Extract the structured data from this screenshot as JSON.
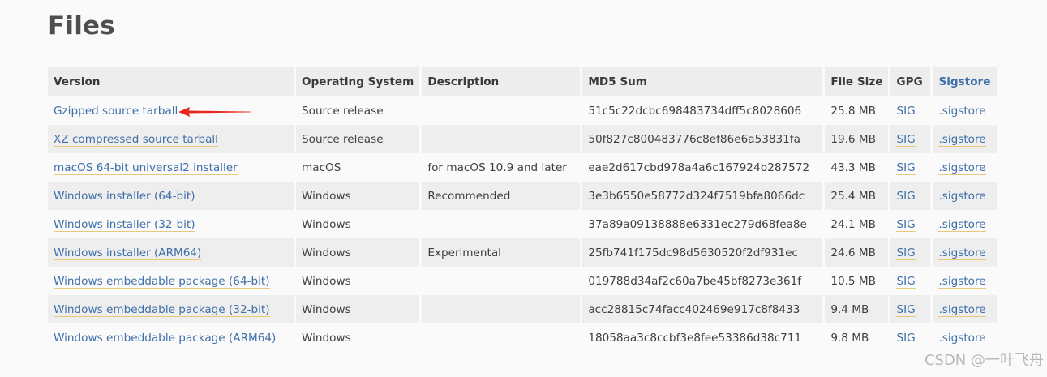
{
  "page": {
    "title": "Files"
  },
  "table": {
    "headers": {
      "version": "Version",
      "os": "Operating System",
      "description": "Description",
      "md5": "MD5 Sum",
      "size": "File Size",
      "gpg": "GPG",
      "sigstore": "Sigstore"
    },
    "rows": [
      {
        "version": "Gzipped source tarball",
        "os": "Source release",
        "description": "",
        "md5": "51c5c22dcbc698483734dff5c8028606",
        "size": "25.8 MB",
        "gpg": "SIG",
        "sigstore": ".sigstore"
      },
      {
        "version": "XZ compressed source tarball",
        "os": "Source release",
        "description": "",
        "md5": "50f827c800483776c8ef86e6a53831fa",
        "size": "19.6 MB",
        "gpg": "SIG",
        "sigstore": ".sigstore"
      },
      {
        "version": "macOS 64-bit universal2 installer",
        "os": "macOS",
        "description": "for macOS 10.9 and later",
        "md5": "eae2d617cbd978a4a6c167924b287572",
        "size": "43.3 MB",
        "gpg": "SIG",
        "sigstore": ".sigstore"
      },
      {
        "version": "Windows installer (64-bit)",
        "os": "Windows",
        "description": "Recommended",
        "md5": "3e3b6550e58772d324f7519bfa8066dc",
        "size": "25.4 MB",
        "gpg": "SIG",
        "sigstore": ".sigstore"
      },
      {
        "version": "Windows installer (32-bit)",
        "os": "Windows",
        "description": "",
        "md5": "37a89a09138888e6331ec279d68fea8e",
        "size": "24.1 MB",
        "gpg": "SIG",
        "sigstore": ".sigstore"
      },
      {
        "version": "Windows installer (ARM64)",
        "os": "Windows",
        "description": "Experimental",
        "md5": "25fb741f175dc98d5630520f2df931ec",
        "size": "24.6 MB",
        "gpg": "SIG",
        "sigstore": ".sigstore"
      },
      {
        "version": "Windows embeddable package (64-bit)",
        "os": "Windows",
        "description": "",
        "md5": "019788d34af2c60a7be45bf8273e361f",
        "size": "10.5 MB",
        "gpg": "SIG",
        "sigstore": ".sigstore"
      },
      {
        "version": "Windows embeddable package (32-bit)",
        "os": "Windows",
        "description": "",
        "md5": "acc28815c74facc402469e917c8f8433",
        "size": "9.4 MB",
        "gpg": "SIG",
        "sigstore": ".sigstore"
      },
      {
        "version": "Windows embeddable package (ARM64)",
        "os": "Windows",
        "description": "",
        "md5": "18058aa3c8ccbf3e8fee53386d38c711",
        "size": "9.8 MB",
        "gpg": "SIG",
        "sigstore": ".sigstore"
      }
    ]
  },
  "annotation": {
    "arrow_color": "#e8281e"
  },
  "watermark": {
    "text": "CSDN @一叶飞舟"
  },
  "colors": {
    "link": "#3e6fa9",
    "link_underline": "#e8c87a",
    "header_bg": "#ededed",
    "stripe_bg": "#eeeeee",
    "page_bg": "#fafafa"
  }
}
